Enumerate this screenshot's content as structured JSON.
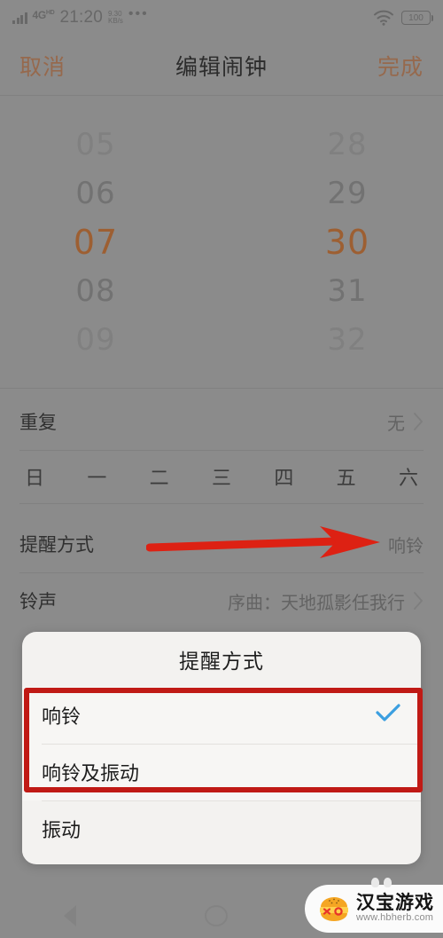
{
  "statusbar": {
    "network_type": "4G",
    "network_type_sup": "HD",
    "time": "21:20",
    "net_speed_value": "9.30",
    "net_speed_unit": "KB/s",
    "overflow_dots": "•••",
    "wifi_icon": "wifi-icon",
    "battery_level": "100"
  },
  "titlebar": {
    "cancel_label": "取消",
    "title": "编辑闹钟",
    "done_label": "完成",
    "accent_color": "#a8714f"
  },
  "time_picker": {
    "hours": [
      "05",
      "06",
      "07",
      "08",
      "09"
    ],
    "hours_selected": "07",
    "minutes": [
      "28",
      "29",
      "30",
      "31",
      "32"
    ],
    "minutes_selected": "30",
    "selected_color": "#b0642e"
  },
  "rows": {
    "repeat": {
      "label": "重复",
      "value": "无",
      "chevron": "chevron-right-icon"
    },
    "weekdays": [
      "日",
      "一",
      "二",
      "三",
      "四",
      "五",
      "六"
    ],
    "alert_mode": {
      "label": "提醒方式",
      "value": "响铃"
    },
    "ringtone": {
      "label": "铃声",
      "value": "序曲：天地孤影任我行",
      "chevron": "chevron-right-icon"
    }
  },
  "annotations": {
    "arrow_color": "#dd2113",
    "highlight_box_color": "#c01a15"
  },
  "dialog": {
    "title": "提醒方式",
    "options": [
      {
        "label": "响铃",
        "checked": true
      },
      {
        "label": "响铃及振动",
        "checked": false
      },
      {
        "label": "振动",
        "checked": false
      }
    ],
    "check_icon": "check-icon",
    "check_color": "#3b9fe0"
  },
  "watermark": {
    "name": "汉宝游戏",
    "url": "www.hbherb.com",
    "logo": "burger-logo-icon"
  }
}
